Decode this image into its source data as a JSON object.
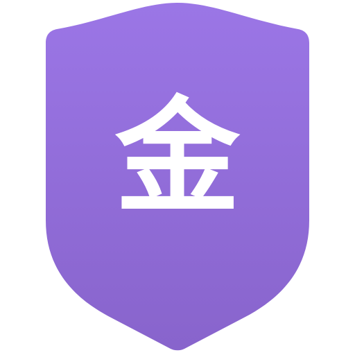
{
  "icon": {
    "name": "shield-icon",
    "character": "金",
    "colors": {
      "gradient_top": "#9b76e6",
      "gradient_bottom": "#8864cc",
      "glyph": "#ffffff",
      "background": "#ffffff"
    }
  }
}
